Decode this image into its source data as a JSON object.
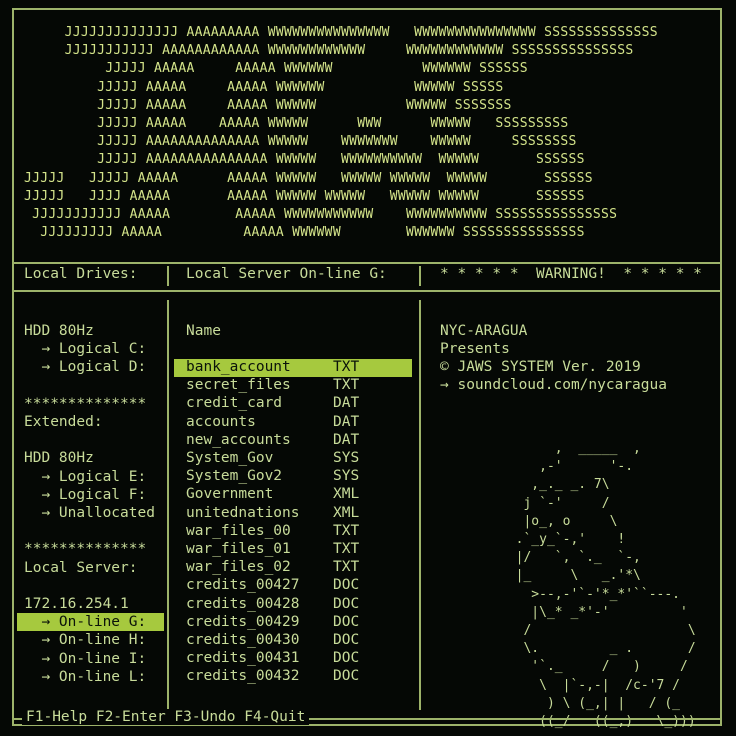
{
  "banner_art": [
    "     JJJJJJJJJJJJJJ AAAAAAAAA WWWWWWWWWWWWWWW   WWWWWWWWWWWWWWW SSSSSSSSSSSSSS",
    "     JJJJJJJJJJJ AAAAAAAAAAAA WWWWWWWWWWWW     WWWWWWWWWWWW SSSSSSSSSSSSSSS",
    "          JJJJJ AAAAA     AAAAA WWWWWW           WWWWWW SSSSSS",
    "         JJJJJ AAAAA     AAAAA WWWWWW           WWWWW SSSSS",
    "         JJJJJ AAAAA     AAAAA WWWWW           WWWWW SSSSSSS",
    "         JJJJJ AAAAA    AAAAA WWWWW      WWW      WWWWW   SSSSSSSSS",
    "         JJJJJ AAAAAAAAAAAAAA WWWWW    WWWWWWW    WWWWW     SSSSSSSS",
    "         JJJJJ AAAAAAAAAAAAAAA WWWWW   WWWWWWWWWW  WWWWW       SSSSSS",
    "JJJJJ   JJJJJ AAAAA      AAAAA WWWWW   WWWWW WWWWW  WWWWW       SSSSSS",
    "JJJJJ   JJJJ AAAAA       AAAAA WWWWW WWWWW   WWWWW WWWWW       SSSSSS",
    " JJJJJJJJJJJ AAAAA        AAAAA WWWWWWWWWWW    WWWWWWWWWW SSSSSSSSSSSSSSS",
    "  JJJJJJJJJ AAAAA          AAAAA WWWWWW        WWWWWW SSSSSSSSSSSSSSS"
  ],
  "headers": {
    "drives": "Local Drives:",
    "server": "Local Server On-line G:",
    "warning": "* * * * *  WARNING!  * * * * *"
  },
  "left_panel": [
    "HDD 80Hz",
    "  → Logical C:",
    "  → Logical D:",
    "",
    "**************",
    "Extended:",
    "",
    "HDD 80Hz",
    "  → Logical E:",
    "  → Logical F:",
    "  → Unallocated",
    "",
    "**************",
    "Local Server:",
    "",
    "172.16.254.1",
    "  → On-line G:",
    "  → On-line H:",
    "  → On-line I:",
    "  → On-line L:"
  ],
  "file_list": {
    "column_header": "Name",
    "files": [
      {
        "name": "bank_account",
        "type": "TXT"
      },
      {
        "name": "secret_files",
        "type": "TXT"
      },
      {
        "name": "credit_card",
        "type": "DAT"
      },
      {
        "name": "accounts",
        "type": "DAT"
      },
      {
        "name": "new_accounts",
        "type": "DAT"
      },
      {
        "name": "System_Gov",
        "type": "SYS"
      },
      {
        "name": "System_Gov2",
        "type": "SYS"
      },
      {
        "name": "Government",
        "type": "XML"
      },
      {
        "name": "unitednations",
        "type": "XML"
      },
      {
        "name": "war_files_00",
        "type": "TXT"
      },
      {
        "name": "war_files_01",
        "type": "TXT"
      },
      {
        "name": "war_files_02",
        "type": "TXT"
      },
      {
        "name": "credits_00427",
        "type": "DOC"
      },
      {
        "name": "credits_00428",
        "type": "DOC"
      },
      {
        "name": "credits_00429",
        "type": "DOC"
      },
      {
        "name": "credits_00430",
        "type": "DOC"
      },
      {
        "name": "credits_00431",
        "type": "DOC"
      },
      {
        "name": "credits_00432",
        "type": "DOC"
      }
    ]
  },
  "info": {
    "line1": "NYC-ARAGUA",
    "line2": "Presents",
    "line3": "© JAWS SYSTEM Ver. 2019",
    "line4": "→ soundcloud.com/nycaragua"
  },
  "shark_art": [
    "       ,  _____  ,",
    "     ,-'      '-.",
    "    ,_._ _. 7\\",
    "   j `-'     /",
    "   |o_, o     \\",
    "  .`_y_`-,'    !",
    "  |/   `, `._  `-,",
    "  |_     \\   _.'*\\",
    "    >--,-'`-'*_*'``---.",
    "    |\\_* _*'-'         '",
    "   /                    \\",
    "   \\.         _ .       /",
    "    '`._     /   )     /",
    "     \\  |`-,-|  /c-'7 /",
    "      ) \\ (_,| |   / (_",
    "     ((_/   ((_;)   \\_)))"
  ],
  "footer": "F1-Help F2-Enter F3-Undo F4-Quit",
  "colors": {
    "background": "#050805",
    "text": "#c8dc9a",
    "border": "#9db36a",
    "highlight": "#a6c93e"
  }
}
